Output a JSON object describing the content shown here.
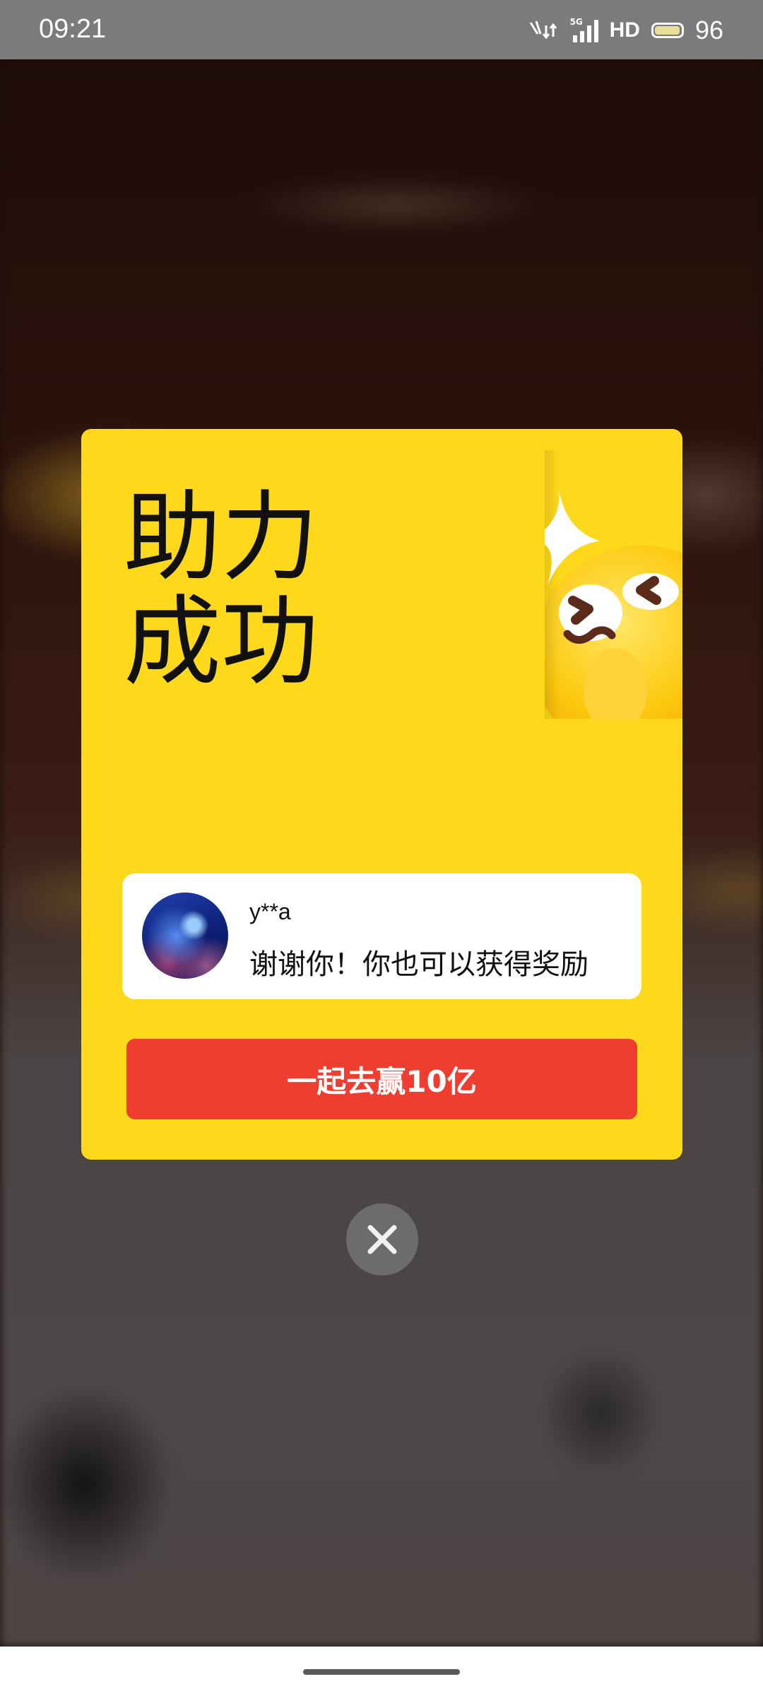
{
  "status_bar": {
    "time": "09:21",
    "network_label": "5G",
    "hd_label": "HD",
    "battery_level": "96",
    "battery_fraction": 0.96
  },
  "modal": {
    "title_line1": "助力",
    "title_line2": "成功",
    "helper": {
      "name": "y**a",
      "message": "谢谢你！你也可以获得奖励"
    },
    "cta_label": "一起去赢10亿"
  },
  "icons": {
    "close": "close-icon",
    "mascot": "wink-emoji-icon",
    "sparkle": "sparkle-icon"
  },
  "colors": {
    "modal_bg": "#fed81a",
    "cta_bg": "#ef3e2f",
    "close_bg": "#6c6c6c"
  }
}
